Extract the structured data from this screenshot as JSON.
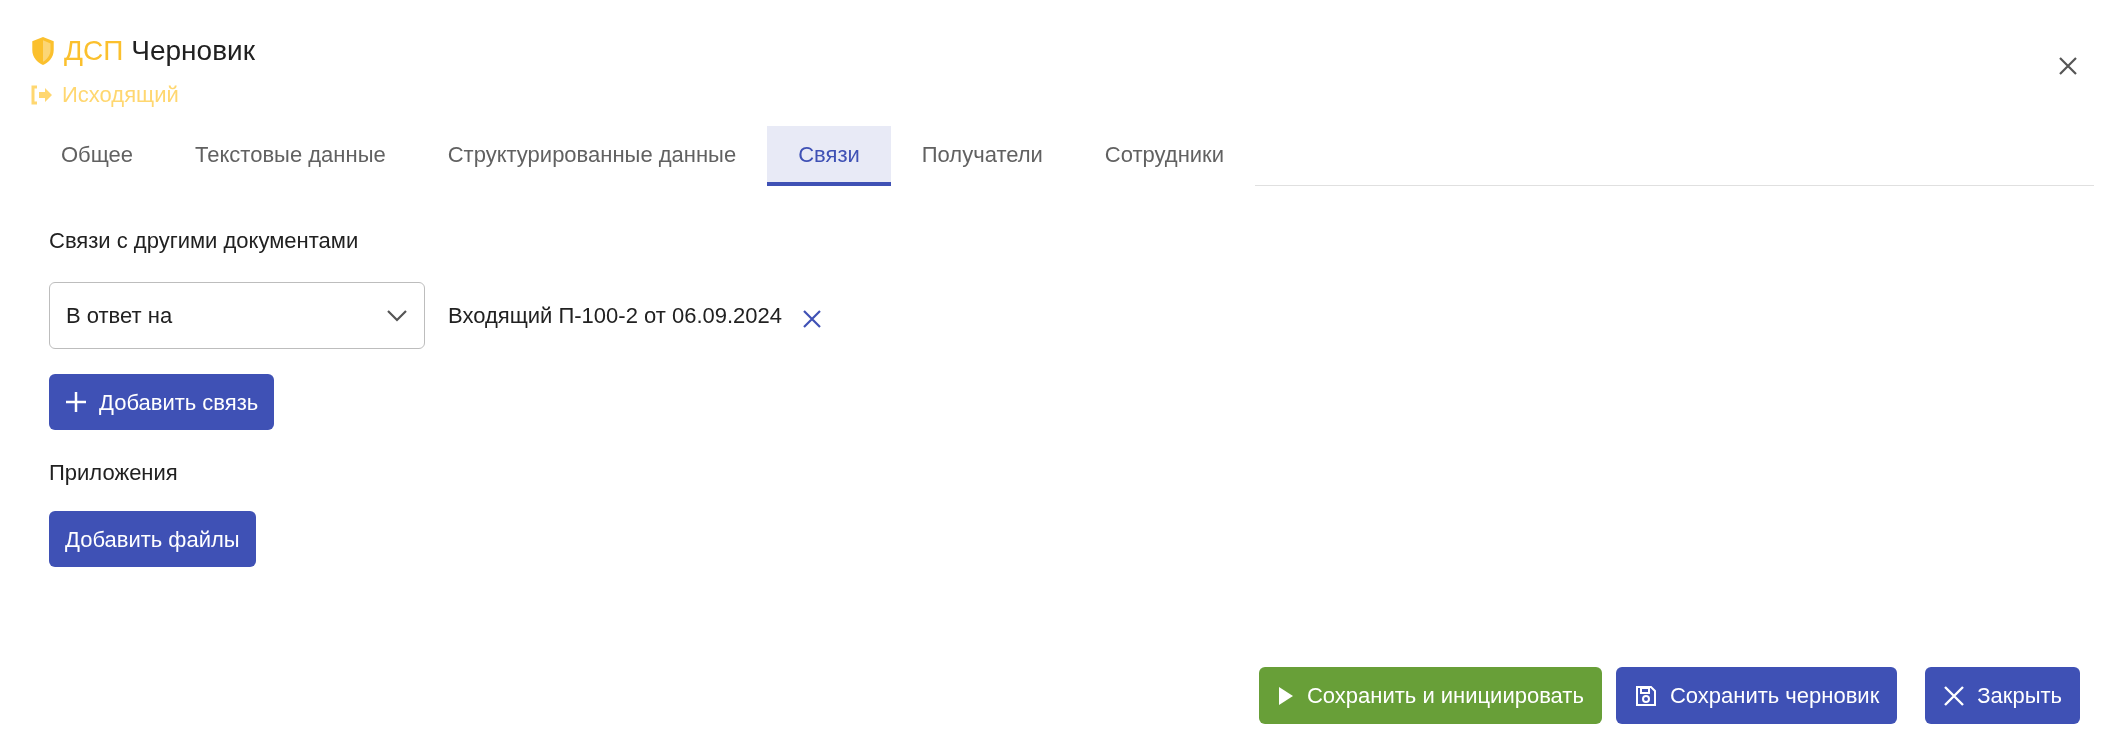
{
  "header": {
    "badge": "ДСП",
    "title": "Черновик",
    "subtitle": "Исходящий"
  },
  "tabs": [
    {
      "label": "Общее",
      "selected": false
    },
    {
      "label": "Текстовые данные",
      "selected": false
    },
    {
      "label": "Структурированные данные",
      "selected": false
    },
    {
      "label": "Связи",
      "selected": true
    },
    {
      "label": "Получатели",
      "selected": false
    },
    {
      "label": "Сотрудники",
      "selected": false
    }
  ],
  "links_section": {
    "title": "Связи с другими документами",
    "links": [
      {
        "type": "В ответ на",
        "document": "Входящий П-100-2 от 06.09.2024"
      }
    ],
    "add_button": "Добавить связь"
  },
  "attachments_section": {
    "title": "Приложения",
    "add_button": "Добавить файлы"
  },
  "footer_buttons": [
    {
      "kind": "play",
      "label": "Сохранить и инициировать",
      "color": "#689f38"
    },
    {
      "kind": "save",
      "label": "Сохранить черновик",
      "color": "#3f51b5"
    },
    {
      "kind": "close",
      "label": "Закрыть",
      "color": "#3f51b5"
    }
  ]
}
